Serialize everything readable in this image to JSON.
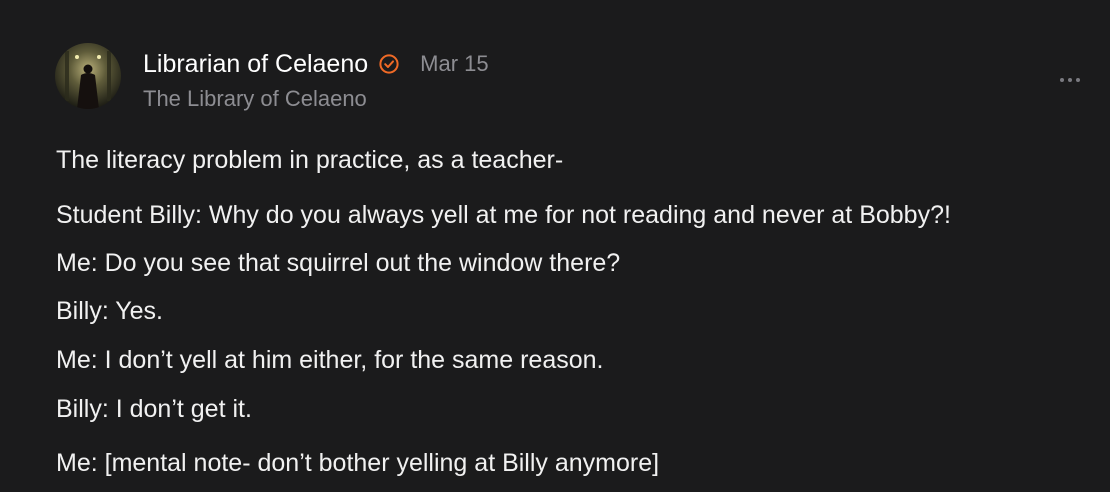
{
  "post": {
    "author": "Librarian of Celaeno",
    "date": "Mar 15",
    "publication": "The Library of Celaeno",
    "verified_icon": "verified-check-icon",
    "more_icon": "more-horizontal-icon",
    "accent_color": "#f06a26",
    "lines": [
      "The literacy problem in practice, as a teacher-",
      "Student Billy: Why do you always yell at me for not reading and never at Bobby?!",
      "Me: Do you see that squirrel out the window there?",
      "Billy: Yes.",
      "Me: I don’t yell at him either, for the same reason.",
      "Billy: I don’t get it.",
      "Me: [mental note- don’t bother yelling at Billy anymore]"
    ]
  }
}
